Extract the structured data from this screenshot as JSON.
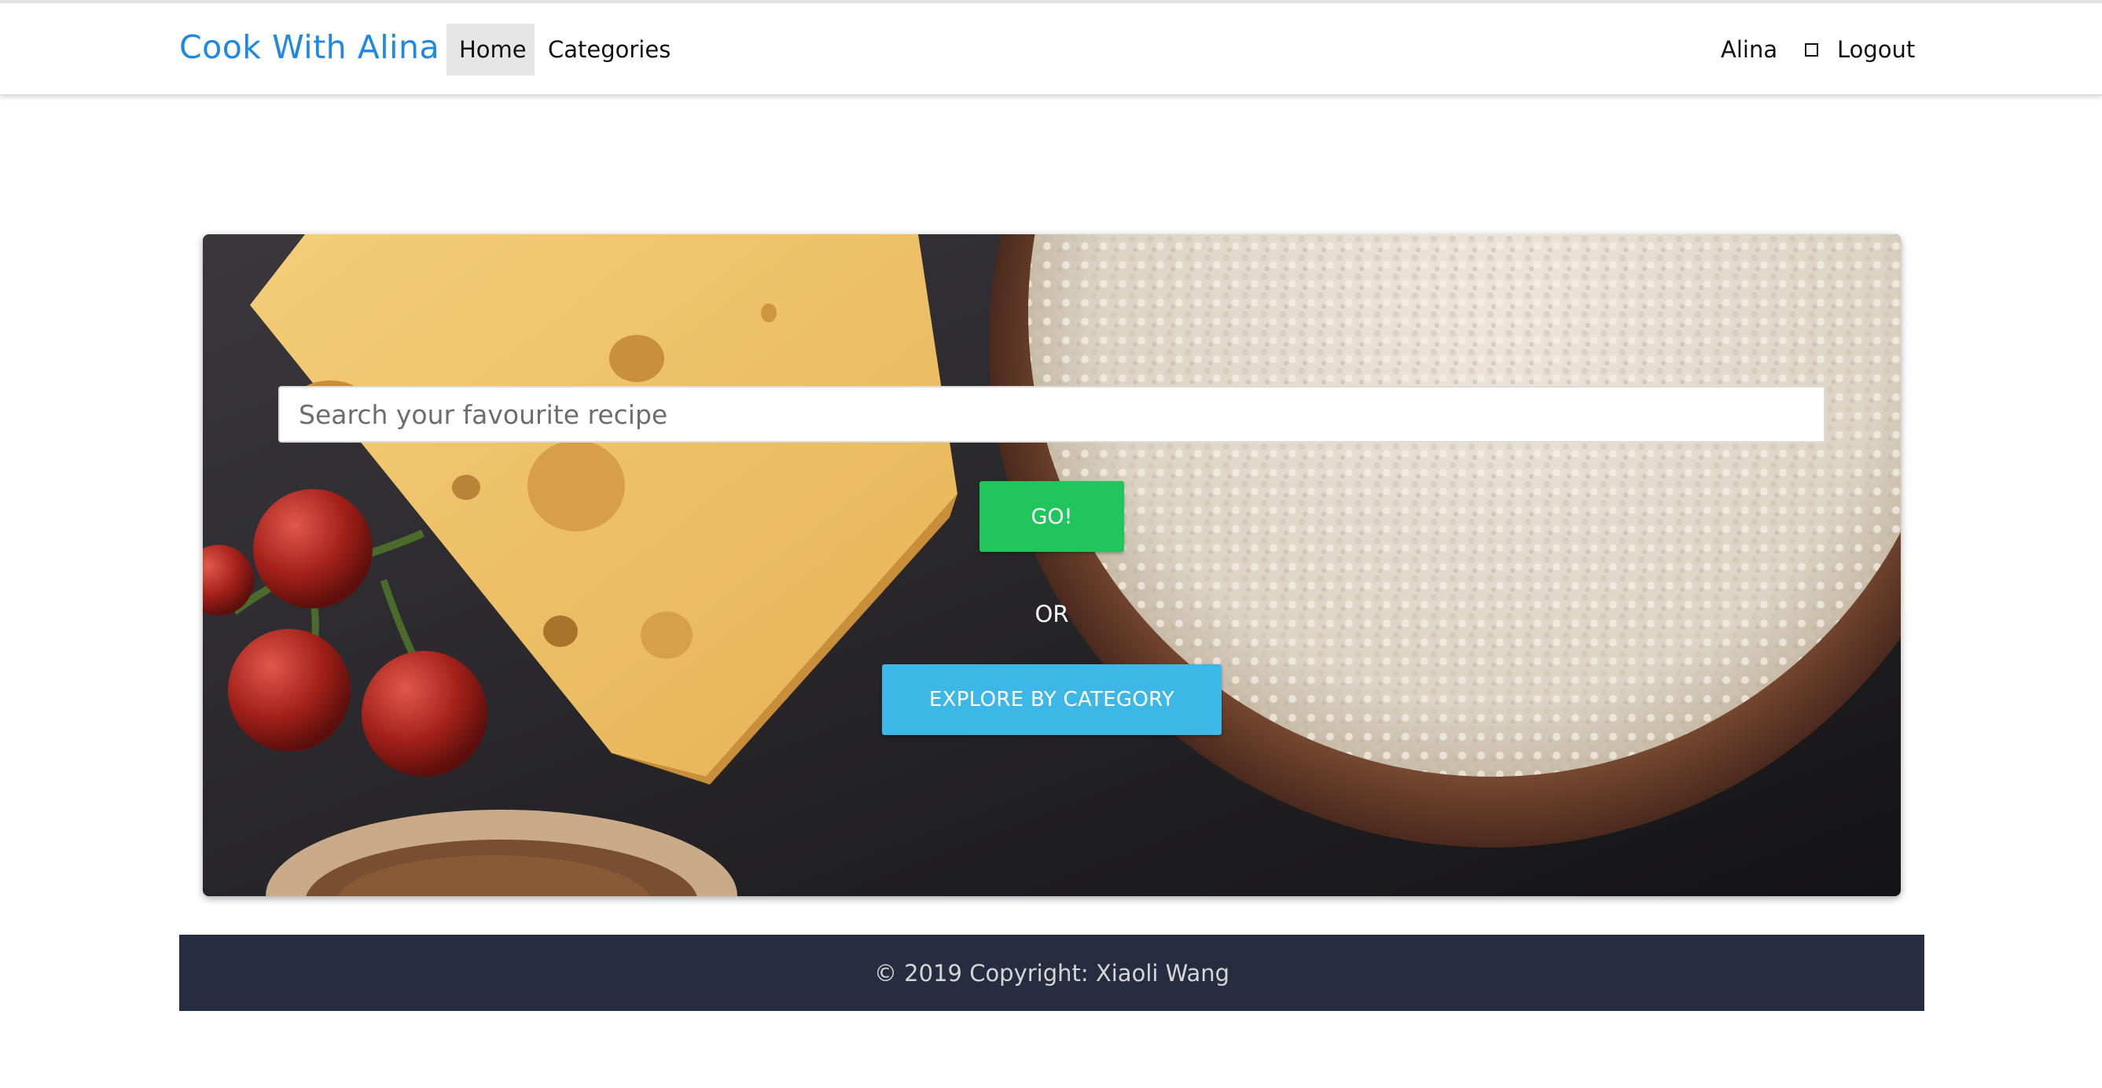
{
  "navbar": {
    "brand": "Cook With Alina",
    "links": [
      {
        "label": "Home",
        "active": true
      },
      {
        "label": "Categories",
        "active": false
      }
    ],
    "user_name": "Alina",
    "logout_label": "Logout",
    "logout_icon": "square-outline-icon"
  },
  "hero": {
    "search_placeholder": "Search your favourite recipe",
    "search_value": "",
    "go_label": "GO!",
    "or_text": "OR",
    "explore_label": "EXPLORE BY CATEGORY"
  },
  "footer": {
    "text": "© 2019 Copyright: Xiaoli Wang"
  },
  "colors": {
    "brand": "#1e88e5",
    "go_button": "#21c55d",
    "explore_button": "#3db8e6",
    "footer_bg": "#272d40",
    "active_nav_bg": "#e6e6e6"
  }
}
